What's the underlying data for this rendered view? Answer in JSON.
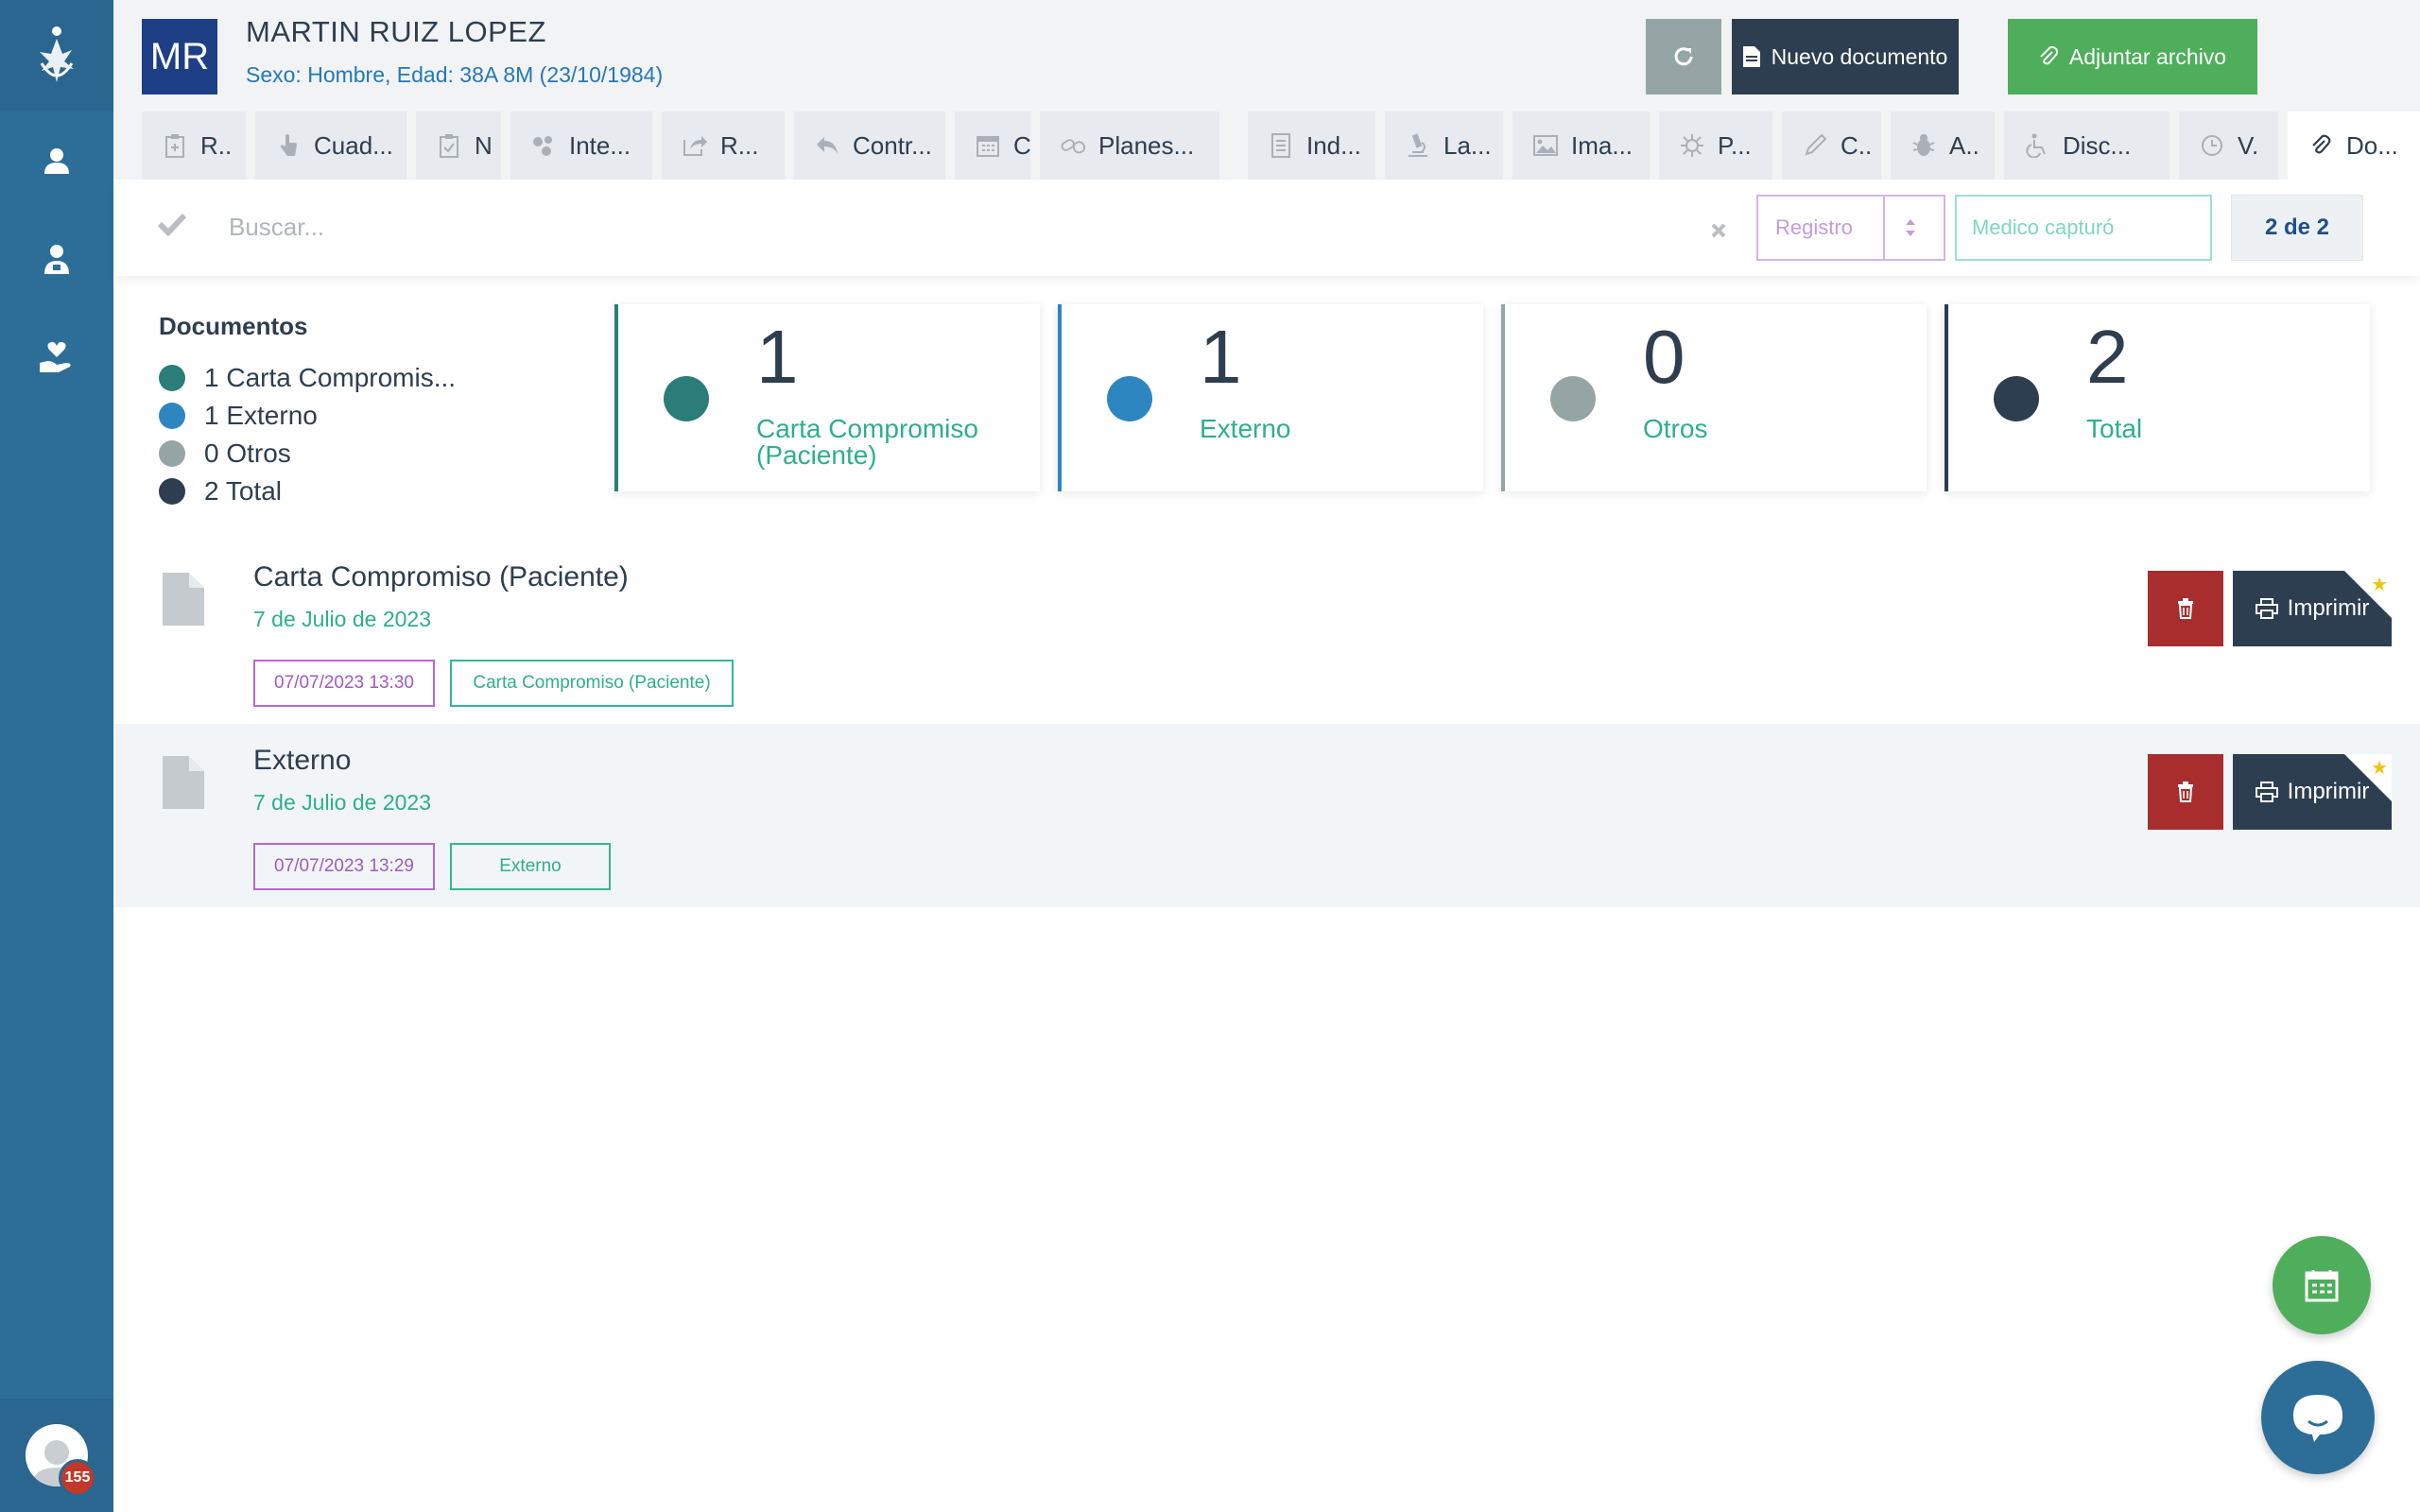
{
  "patient": {
    "initials": "MR",
    "name": "MARTIN RUIZ LOPEZ",
    "info": "Sexo: Hombre, Edad: 38A 8M (23/10/1984)"
  },
  "header_buttons": {
    "new_document": "Nuevo documento",
    "attach_file": "Adjuntar archivo"
  },
  "tabs": [
    {
      "label": "R..",
      "icon": "clipboard-plus-icon"
    },
    {
      "label": "Cuad...",
      "icon": "hand-pointer-icon"
    },
    {
      "label": "N",
      "icon": "clipboard-check-icon"
    },
    {
      "label": "Inte...",
      "icon": "users-icon"
    },
    {
      "label": "R...",
      "icon": "share-icon"
    },
    {
      "label": "Contr...",
      "icon": "reply-icon"
    },
    {
      "label": "C",
      "icon": "calendar-icon"
    },
    {
      "label": "Planes...",
      "icon": "pills-icon"
    },
    {
      "label": "Ind...",
      "icon": "document-list-icon"
    },
    {
      "label": "La...",
      "icon": "microscope-icon"
    },
    {
      "label": "Ima...",
      "icon": "image-icon"
    },
    {
      "label": "P...",
      "icon": "virus-icon"
    },
    {
      "label": "C..",
      "icon": "pen-icon"
    },
    {
      "label": "A..",
      "icon": "bug-icon"
    },
    {
      "label": "Disc...",
      "icon": "wheelchair-icon"
    },
    {
      "label": "V.",
      "icon": "clock-icon"
    },
    {
      "label": "Do...",
      "icon": "paperclip-icon"
    }
  ],
  "search": {
    "placeholder": "Buscar...",
    "registro_placeholder": "Registro",
    "medico_placeholder": "Medico capturó",
    "page_count": "2 de 2"
  },
  "legend": {
    "title": "Documentos",
    "items": [
      {
        "label": "1 Carta Compromis...",
        "color": "#2a7d78"
      },
      {
        "label": "1 Externo",
        "color": "#2e86c1"
      },
      {
        "label": "0 Otros",
        "color": "#95a5a6"
      },
      {
        "label": "2 Total",
        "color": "#2d3e50"
      }
    ]
  },
  "cards": [
    {
      "count": "1",
      "label": "Carta Compromiso (Paciente)",
      "color": "#2a7d78"
    },
    {
      "count": "1",
      "label": "Externo",
      "color": "#2e86c1"
    },
    {
      "count": "0",
      "label": "Otros",
      "color": "#95a5a6"
    },
    {
      "count": "2",
      "label": "Total",
      "color": "#2d3e50"
    }
  ],
  "documents": [
    {
      "title": "Carta Compromiso (Paciente)",
      "date": "7 de Julio de 2023",
      "timestamp": "07/07/2023 13:30",
      "type": "Carta Compromiso (Paciente)",
      "print_label": "Imprimir"
    },
    {
      "title": "Externo",
      "date": "7 de Julio de 2023",
      "timestamp": "07/07/2023 13:29",
      "type": "Externo",
      "print_label": "Imprimir"
    }
  ],
  "notifications": {
    "count": "155"
  }
}
